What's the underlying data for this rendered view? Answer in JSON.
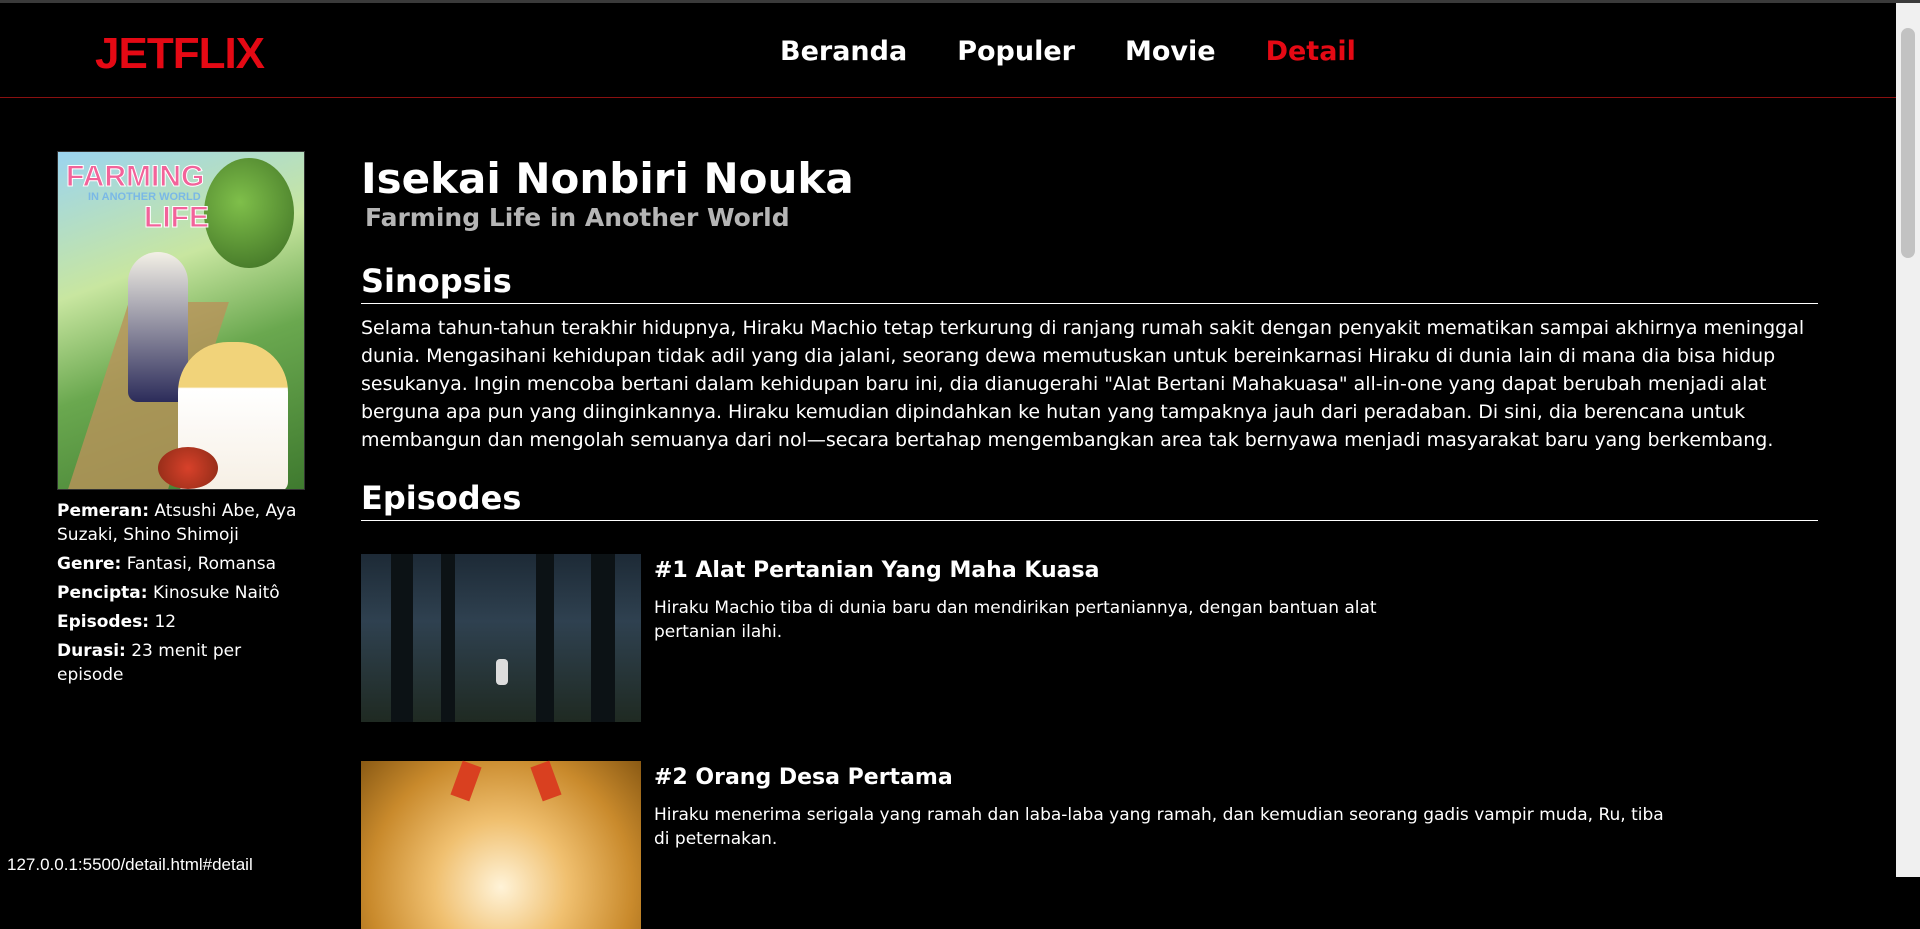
{
  "app": {
    "logo": "JETFLIX"
  },
  "nav": {
    "items": [
      "Beranda",
      "Populer",
      "Movie",
      "Detail"
    ],
    "active": "Detail"
  },
  "poster": {
    "line1": "FARMING",
    "line2": "IN ANOTHER WORLD",
    "line3": "LIFE"
  },
  "meta": {
    "cast_label": "Pemeran:",
    "cast": "Atsushi Abe, Aya Suzaki, Shino Shimoji",
    "genre_label": "Genre:",
    "genre": "Fantasi, Romansa",
    "creator_label": "Pencipta:",
    "creator": "Kinosuke Naitô",
    "episodes_label": "Episodes:",
    "episodes": "12",
    "duration_label": "Durasi:",
    "duration": "23 menit per episode"
  },
  "main": {
    "title": "Isekai Nonbiri Nouka",
    "subtitle": "Farming Life in Another World",
    "synopsis_heading": "Sinopsis",
    "synopsis": "Selama tahun-tahun terakhir hidupnya, Hiraku Machio tetap terkurung di ranjang rumah sakit dengan penyakit mematikan sampai akhirnya meninggal dunia. Mengasihani kehidupan tidak adil yang dia jalani, seorang dewa memutuskan untuk bereinkarnasi Hiraku di dunia lain di mana dia bisa hidup sesukanya. Ingin mencoba bertani dalam kehidupan baru ini, dia dianugerahi \"Alat Bertani Mahakuasa\" all-in-one yang dapat berubah menjadi alat berguna apa pun yang diinginkannya. Hiraku kemudian dipindahkan ke hutan yang tampaknya jauh dari peradaban. Di sini, dia berencana untuk membangun dan mengolah semuanya dari nol—secara bertahap mengembangkan area tak bernyawa menjadi masyarakat baru yang berkembang.",
    "episodes_heading": "Episodes"
  },
  "episodes": [
    {
      "title": "#1 Alat Pertanian Yang Maha Kuasa",
      "desc": "Hiraku Machio tiba di dunia baru dan mendirikan pertaniannya, dengan bantuan alat pertanian ilahi."
    },
    {
      "title": "#2 Orang Desa Pertama",
      "desc": "Hiraku menerima serigala yang ramah dan laba-laba yang ramah, dan kemudian seorang gadis vampir muda, Ru, tiba di peternakan."
    }
  ],
  "status": {
    "url": "127.0.0.1:5500/detail.html#detail"
  },
  "colors": {
    "accent": "#e50914",
    "background": "#000000"
  }
}
